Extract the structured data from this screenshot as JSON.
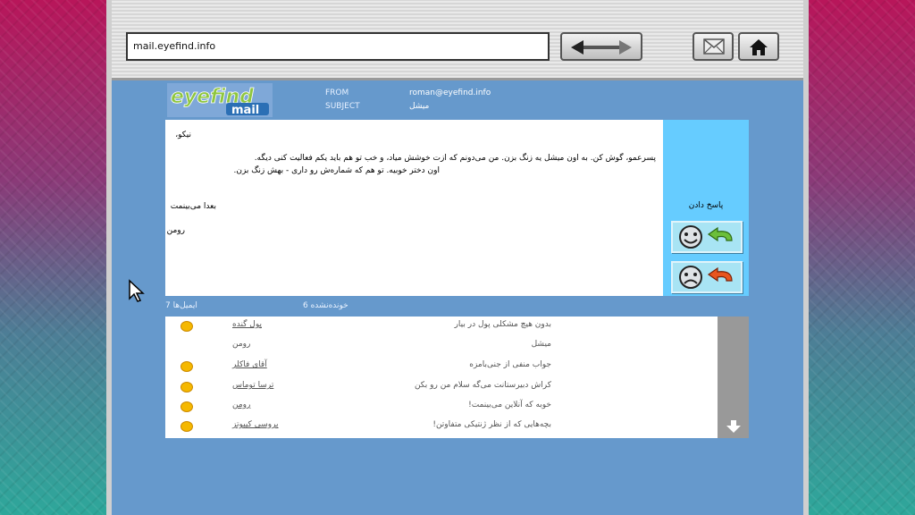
{
  "browser": {
    "url": "mail.eyefind.info",
    "icons": {
      "back_forward": "back-forward-arrows-icon",
      "mail": "mail-envelope-icon",
      "home": "home-icon"
    }
  },
  "logo": {
    "top": "eyefind",
    "bottom": "mail"
  },
  "header": {
    "from_label": "FROM",
    "from_value": "roman@eyefind.info",
    "subject_label": "SUBJECT",
    "subject_value": "میشل"
  },
  "message": {
    "greeting": "نیکو،",
    "line1": "پسرعمو، گوش کن. به اون میشل یه زنگ بزن. من می‌دونم که ازت خوشش میاد، و خب تو هم باید یکم فعالیت کنی دیگه.",
    "line2": "اون دختر خوبیه. تو هم که شماره‌ش رو داری - بهش زنگ بزن.",
    "signoff": "بعدا می‌بینمت",
    "signature": "رومن"
  },
  "sidebar": {
    "reply_label": "پاسخ دادن"
  },
  "counts": {
    "emails": "ایمیل‌ها 7",
    "unread": "خونده‌نشده 6"
  },
  "inbox": [
    {
      "sender": "پول گنده",
      "subject": "بدون هیچ مشکلی پول در بیار",
      "unread": true
    },
    {
      "sender": "رومن",
      "subject": "میشل",
      "unread": false
    },
    {
      "sender": "آقای فاکلر",
      "subject": "جواب منفی از جنی‌بامزه",
      "unread": true
    },
    {
      "sender": "ترسا توماس",
      "subject": "کراش دبیرستانت می‌گه سلام من رو بکن",
      "unread": true
    },
    {
      "sender": "رومن",
      "subject": "خوبه که آنلاین می‌بینمت!",
      "unread": true
    },
    {
      "sender": "بروسی کیبوتز",
      "subject": "بچه‌هایی که از نظر ژنتیکی متفاوتن!",
      "unread": true
    }
  ],
  "colors": {
    "page": "#6699cc",
    "sidebar": "#66ccff",
    "unread_dot": "#f5b800"
  }
}
